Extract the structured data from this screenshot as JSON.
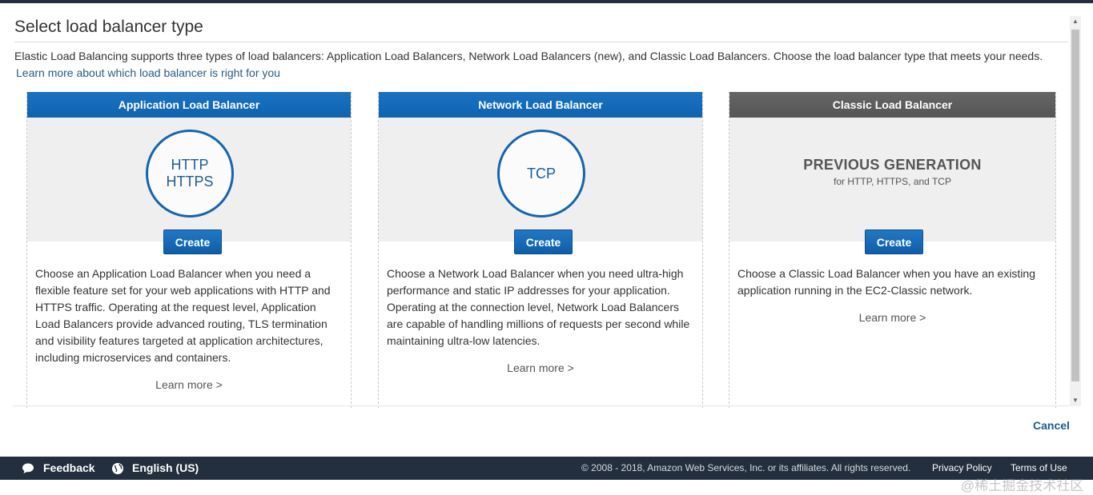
{
  "page": {
    "title": "Select load balancer type",
    "description": "Elastic Load Balancing supports three types of load balancers: Application Load Balancers, Network Load Balancers (new), and Classic Load Balancers. Choose the load balancer type that meets your needs.",
    "learn_more_link": "Learn more about which load balancer is right for you"
  },
  "cards": [
    {
      "header": "Application Load Balancer",
      "protocol_lines": [
        "HTTP",
        "HTTPS"
      ],
      "create_label": "Create",
      "description": "Choose an Application Load Balancer when you need a flexible feature set for your web applications with HTTP and HTTPS traffic. Operating at the request level, Application Load Balancers provide advanced routing, TLS termination and visibility features targeted at application architectures, including microservices and containers.",
      "learn_more": "Learn more >",
      "header_color": "#0f6cbd"
    },
    {
      "header": "Network Load Balancer",
      "protocol_lines": [
        "TCP"
      ],
      "create_label": "Create",
      "description": "Choose a Network Load Balancer when you need ultra-high performance and static IP addresses for your application. Operating at the connection level, Network Load Balancers are capable of handling millions of requests per second while maintaining ultra-low latencies.",
      "learn_more": "Learn more >",
      "header_color": "#0f6cbd"
    },
    {
      "header": "Classic Load Balancer",
      "generation_title": "PREVIOUS GENERATION",
      "generation_subtitle": "for HTTP, HTTPS, and TCP",
      "create_label": "Create",
      "description": "Choose a Classic Load Balancer when you have an existing application running in the EC2-Classic network.",
      "learn_more": "Learn more >",
      "header_color": "#5a5a5a"
    }
  ],
  "actions": {
    "cancel": "Cancel"
  },
  "footer": {
    "feedback": "Feedback",
    "language": "English (US)",
    "copyright": "© 2008 - 2018, Amazon Web Services, Inc. or its affiliates. All rights reserved.",
    "privacy": "Privacy Policy",
    "terms": "Terms of Use",
    "feedback_icon": "speech-bubble-icon",
    "language_icon": "globe-icon"
  },
  "watermark": "@稀土掘金技术社区",
  "colors": {
    "primary_blue": "#1368b6",
    "footer_bg": "#232f3e",
    "link": "#2a5b84"
  }
}
